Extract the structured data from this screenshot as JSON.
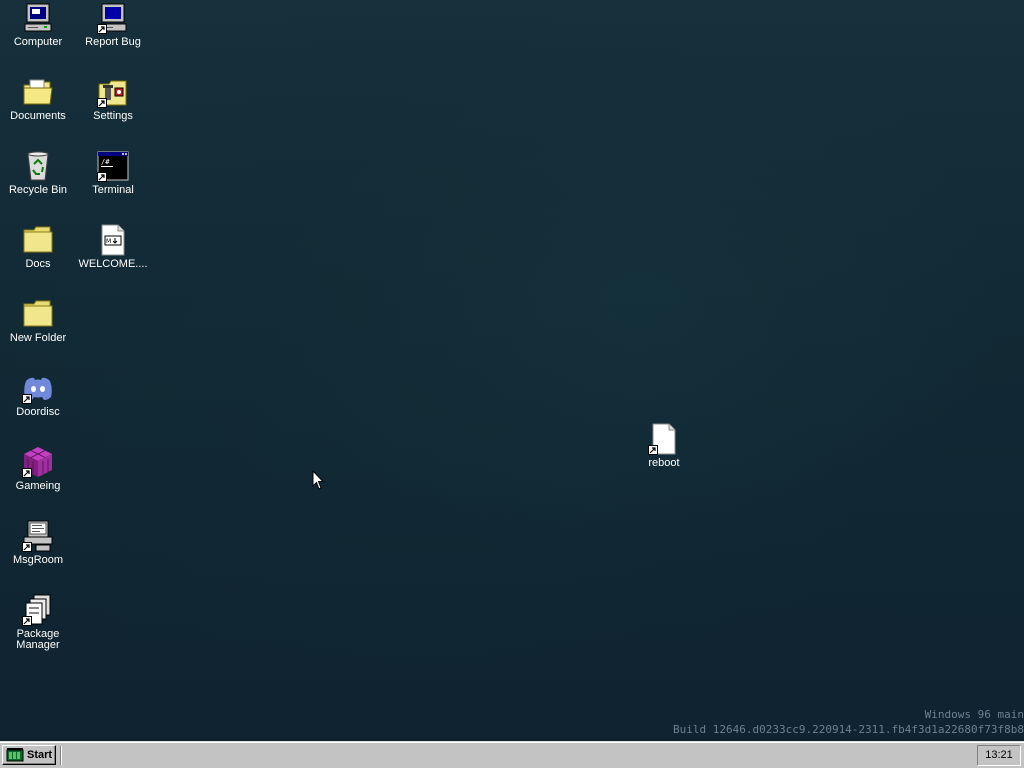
{
  "desktop": {
    "icons": [
      {
        "label": "Computer",
        "icon": "computer-icon"
      },
      {
        "label": "Report Bug",
        "icon": "report-bug-icon"
      },
      {
        "label": "Documents",
        "icon": "documents-folder-icon"
      },
      {
        "label": "Settings",
        "icon": "settings-icon"
      },
      {
        "label": "Recycle Bin",
        "icon": "recycle-bin-icon"
      },
      {
        "label": "Terminal",
        "icon": "terminal-icon"
      },
      {
        "label": "Docs",
        "icon": "folder-icon"
      },
      {
        "label": "WELCOME....",
        "icon": "markdown-file-icon"
      },
      {
        "label": "New Folder",
        "icon": "folder-icon"
      },
      {
        "label": "Doordisc",
        "icon": "doordisc-icon"
      },
      {
        "label": "Gameing",
        "icon": "game-cube-icon"
      },
      {
        "label": "MsgRoom",
        "icon": "msgroom-icon"
      },
      {
        "label": "Package Manager",
        "icon": "package-manager-icon"
      },
      {
        "label": "reboot",
        "icon": "file-icon"
      }
    ]
  },
  "watermark": {
    "line1": "Windows 96 main",
    "line2": "Build 12646.d0233cc9.220914-2311.fb4f3d1a22680f73f8b8"
  },
  "taskbar": {
    "start_label": "Start",
    "clock": "13:21"
  },
  "colors": {
    "desktop_bg": "#122a35",
    "taskbar_bg": "#c3c3c3",
    "folder_yellow": "#f0e68c",
    "label_text": "#ffffff"
  }
}
